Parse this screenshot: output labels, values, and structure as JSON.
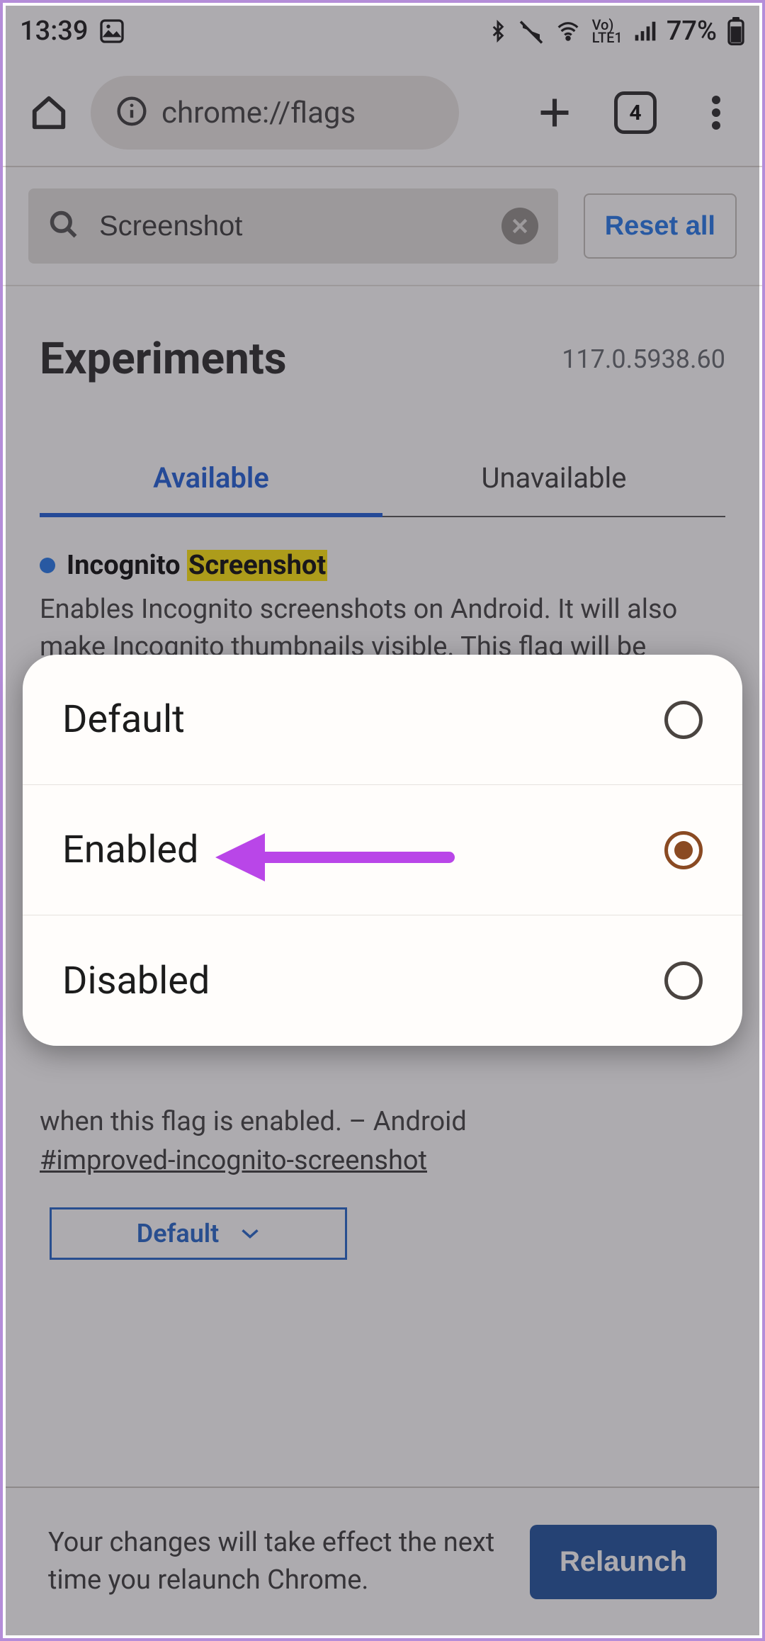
{
  "statusbar": {
    "time": "13:39",
    "battery": "77%"
  },
  "toolbar": {
    "url": "chrome://flags",
    "tab_count": "4"
  },
  "search": {
    "value": "Screenshot",
    "reset_label": "Reset all"
  },
  "header": {
    "title": "Experiments",
    "version": "117.0.5938.60"
  },
  "tabs": {
    "available": "Available",
    "unavailable": "Unavailable"
  },
  "flag1": {
    "title_prefix": "Incognito ",
    "title_highlight": "Screenshot",
    "desc": "Enables Incognito screenshots on Android. It will also make Incognito thumbnails visible. This flag will be ignored when the ImprovedIncognitoScreenshot flag is enabled. –"
  },
  "flag2": {
    "desc_tail": "when this flag is enabled. – Android",
    "id": "#improved-incognito-screenshot",
    "select_value": "Default"
  },
  "modal": {
    "options": [
      "Default",
      "Enabled",
      "Disabled"
    ],
    "selected_index": 1
  },
  "relaunch": {
    "msg": "Your changes will take effect the next time you relaunch Chrome.",
    "btn": "Relaunch"
  }
}
